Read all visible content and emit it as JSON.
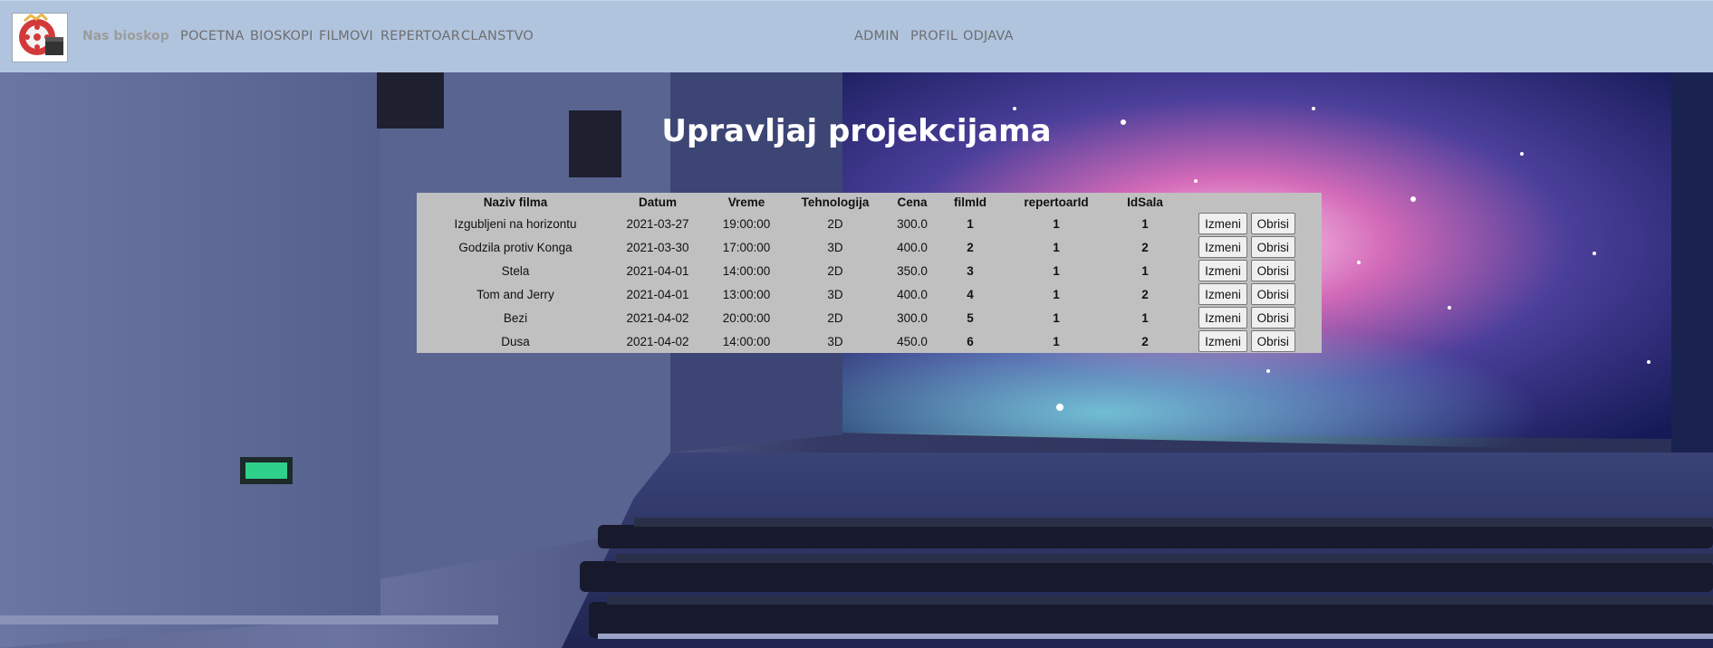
{
  "navbar": {
    "brand": "Nas bioskop",
    "left_links": [
      "POCETNA",
      "BIOSKOPI",
      "FILMOVI",
      "REPERTOAR",
      "CLANSTVO"
    ],
    "right_links": [
      "ADMIN",
      "PROFIL",
      "ODJAVA"
    ]
  },
  "page": {
    "title": "Upravljaj projekcijama"
  },
  "table": {
    "headers": [
      "Naziv filma",
      "Datum",
      "Vreme",
      "Tehnologija",
      "Cena",
      "filmId",
      "repertoarId",
      "IdSala"
    ],
    "rows": [
      [
        "Izgubljeni na horizontu",
        "2021-03-27",
        "19:00:00",
        "2D",
        "300.0",
        "1",
        "1",
        "1"
      ],
      [
        "Godzila protiv Konga",
        "2021-03-30",
        "17:00:00",
        "3D",
        "400.0",
        "2",
        "1",
        "2"
      ],
      [
        "Stela",
        "2021-04-01",
        "14:00:00",
        "2D",
        "350.0",
        "3",
        "1",
        "1"
      ],
      [
        "Tom and Jerry",
        "2021-04-01",
        "13:00:00",
        "3D",
        "400.0",
        "4",
        "1",
        "2"
      ],
      [
        "Bezi",
        "2021-04-02",
        "20:00:00",
        "2D",
        "300.0",
        "5",
        "1",
        "1"
      ],
      [
        "Dusa",
        "2021-04-02",
        "14:00:00",
        "3D",
        "450.0",
        "6",
        "1",
        "2"
      ]
    ],
    "edit_label": "Izmeni",
    "delete_label": "Obrisi"
  },
  "colors": {
    "navbar": "#b0c4de",
    "table_bg": "#c0c0c0",
    "title": "#ffffff"
  },
  "icons": [
    "cinema-logo-icon",
    "exit-sign-icon"
  ]
}
